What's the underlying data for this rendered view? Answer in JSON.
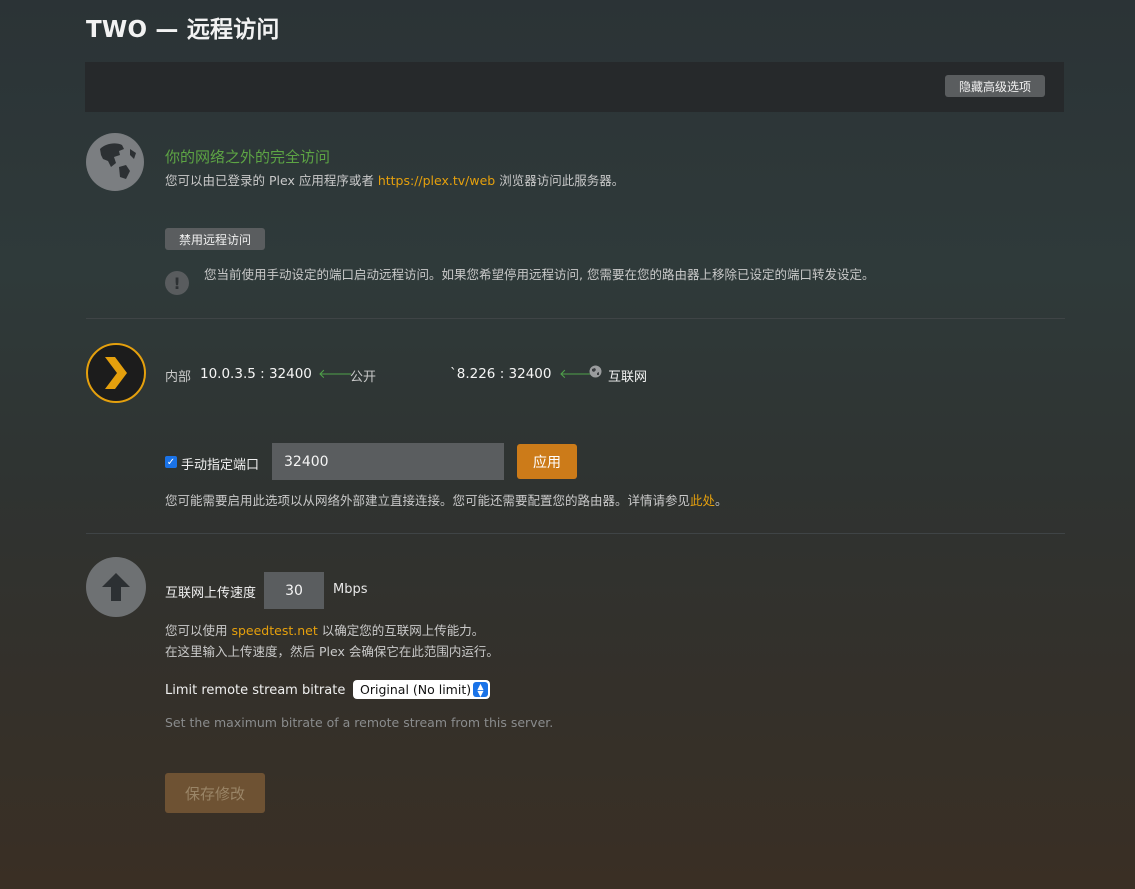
{
  "page": {
    "title": "TWO — 远程访问"
  },
  "toolbar": {
    "hide_advanced_label": "隐藏高级选项"
  },
  "remote": {
    "heading": "你的网络之外的完全访问",
    "desc_pre": "您可以由已登录的 Plex 应用程序或者 ",
    "desc_link": "https://plex.tv/web",
    "desc_post": " 浏览器访问此服务器。",
    "disable_label": "禁用远程访问",
    "warning_text": "您当前使用手动设定的端口启动远程访问。如果您希望停用远程访问, 您需要在您的路由器上移除已设定的端口转发设定。"
  },
  "network": {
    "internal_label": "内部",
    "internal_value": "10.0.3.5 : 32400",
    "public_label": "公开",
    "public_value": "`8.226 : 32400",
    "internet_label": "互联网"
  },
  "port": {
    "checkbox_label": "手动指定端口",
    "checked": true,
    "value": "32400",
    "apply_label": "应用",
    "desc_pre": "您可能需要启用此选项以从网络外部建立直接连接。您可能还需要配置您的路由器。详情请参见",
    "desc_link": "此处",
    "desc_post": "。"
  },
  "upload": {
    "label": "互联网上传速度",
    "value": "30",
    "unit": "Mbps",
    "desc1_pre": "您可以使用 ",
    "desc1_link": "speedtest.net",
    "desc1_post": " 以确定您的互联网上传能力。",
    "desc2": "在这里输入上传速度，然后 Plex 会确保它在此范围内运行。"
  },
  "bitrate": {
    "label": "Limit remote stream bitrate",
    "selected": "Original (No limit)",
    "desc": "Set the maximum bitrate of a remote stream from this server."
  },
  "footer": {
    "save_label": "保存修改"
  },
  "icons": {
    "globe": "globe-icon",
    "warning": "exclamation-icon",
    "plex": "plex-chevron-icon",
    "upload": "upload-arrow-icon",
    "arrow": "arrow-left-icon"
  },
  "colors": {
    "accent": "#e5a00d",
    "green": "#5da444",
    "apply": "#cc7b19"
  }
}
